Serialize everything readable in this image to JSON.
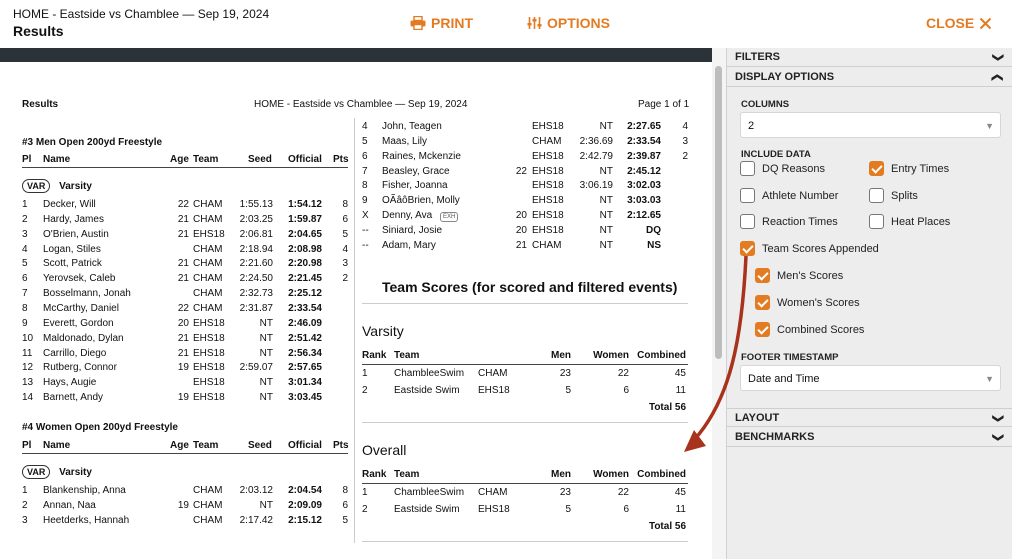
{
  "header": {
    "breadcrumb": "HOME - Eastside vs Chamblee — Sep 19, 2024",
    "title": "Results",
    "print_label": "PRINT",
    "options_label": "OPTIONS",
    "close_label": "CLOSE",
    "accent_color": "#e37b22"
  },
  "doc": {
    "heading_left": "Results",
    "heading_center": "HOME - Eastside vs Chamblee — Sep 19, 2024",
    "page_info": "Page 1 of 1",
    "columns_header": [
      "Pl",
      "Name",
      "Age",
      "Team",
      "Seed",
      "Official",
      "Pts"
    ],
    "event3": {
      "title": "#3 Men Open 200yd Freestyle",
      "group": "VAR",
      "group_label": "Varsity",
      "rows": [
        [
          "1",
          "Decker, Will",
          "22",
          "CHAM",
          "1:55.13",
          "1:54.12",
          "8"
        ],
        [
          "2",
          "Hardy, James",
          "21",
          "CHAM",
          "2:03.25",
          "1:59.87",
          "6"
        ],
        [
          "3",
          "O'Brien, Austin",
          "21",
          "EHS18",
          "2:06.81",
          "2:04.65",
          "5"
        ],
        [
          "4",
          "Logan, Stiles",
          "",
          "CHAM",
          "2:18.94",
          "2:08.98",
          "4"
        ],
        [
          "5",
          "Scott, Patrick",
          "21",
          "CHAM",
          "2:21.60",
          "2:20.98",
          "3"
        ],
        [
          "6",
          "Yerovsek, Caleb",
          "21",
          "CHAM",
          "2:24.50",
          "2:21.45",
          "2"
        ],
        [
          "7",
          "Bosselmann, Jonah",
          "",
          "CHAM",
          "2:32.73",
          "2:25.12",
          ""
        ],
        [
          "8",
          "McCarthy, Daniel",
          "22",
          "CHAM",
          "2:31.87",
          "2:33.54",
          ""
        ],
        [
          "9",
          "Everett, Gordon",
          "20",
          "EHS18",
          "NT",
          "2:46.09",
          ""
        ],
        [
          "10",
          "Maldonado, Dylan",
          "21",
          "EHS18",
          "NT",
          "2:51.42",
          ""
        ],
        [
          "11",
          "Carrillo, Diego",
          "21",
          "EHS18",
          "NT",
          "2:56.34",
          ""
        ],
        [
          "12",
          "Rutberg, Connor",
          "19",
          "EHS18",
          "2:59.07",
          "2:57.65",
          ""
        ],
        [
          "13",
          "Hays, Augie",
          "",
          "EHS18",
          "NT",
          "3:01.34",
          ""
        ],
        [
          "14",
          "Barnett, Andy",
          "19",
          "EHS18",
          "NT",
          "3:03.45",
          ""
        ]
      ]
    },
    "event4": {
      "title": "#4 Women Open 200yd Freestyle",
      "group": "VAR",
      "group_label": "Varsity",
      "rows": [
        [
          "1",
          "Blankenship, Anna",
          "",
          "CHAM",
          "2:03.12",
          "2:04.54",
          "8"
        ],
        [
          "2",
          "Annan, Naa",
          "19",
          "CHAM",
          "NT",
          "2:09.09",
          "6"
        ],
        [
          "3",
          "Heetderks, Hannah",
          "",
          "CHAM",
          "2:17.42",
          "2:15.12",
          "5"
        ]
      ],
      "rows_cont": [
        [
          "4",
          "John, Teagen",
          "",
          "EHS18",
          "NT",
          "2:27.65",
          "4"
        ],
        [
          "5",
          "Maas, Lily",
          "",
          "CHAM",
          "2:36.69",
          "2:33.54",
          "3"
        ],
        [
          "6",
          "Raines, Mckenzie",
          "",
          "EHS18",
          "2:42.79",
          "2:39.87",
          "2"
        ],
        [
          "7",
          "Beasley, Grace",
          "22",
          "EHS18",
          "NT",
          "2:45.12",
          ""
        ],
        [
          "8",
          "Fisher, Joanna",
          "",
          "EHS18",
          "3:06.19",
          "3:02.03",
          ""
        ],
        [
          "9",
          "OÃâôBrien, Molly",
          "",
          "EHS18",
          "NT",
          "3:03.03",
          ""
        ],
        [
          "X",
          "Denny, Ava",
          "20",
          "EHS18",
          "NT",
          "2:12.65",
          ""
        ],
        [
          "--",
          "Siniard, Josie",
          "20",
          "EHS18",
          "NT",
          "DQ",
          ""
        ],
        [
          "--",
          "Adam, Mary",
          "21",
          "CHAM",
          "NT",
          "NS",
          ""
        ]
      ],
      "exh_tag": "EXH"
    },
    "team_scores": {
      "title": "Team Scores (for scored and filtered events)",
      "columns": [
        "Rank",
        "Team",
        "",
        "Men",
        "Women",
        "Combined"
      ],
      "varsity": {
        "label": "Varsity",
        "rows": [
          [
            "1",
            "ChambleeSwim",
            "CHAM",
            "23",
            "22",
            "45"
          ],
          [
            "2",
            "Eastside Swim",
            "EHS18",
            "5",
            "6",
            "11"
          ]
        ],
        "total": "Total 56"
      },
      "overall": {
        "label": "Overall",
        "rows": [
          [
            "1",
            "ChambleeSwim",
            "CHAM",
            "23",
            "22",
            "45"
          ],
          [
            "2",
            "Eastside Swim",
            "EHS18",
            "5",
            "6",
            "11"
          ]
        ],
        "total": "Total 56"
      }
    }
  },
  "panel": {
    "filters": "FILTERS",
    "display_options": "DISPLAY OPTIONS",
    "columns_label": "COLUMNS",
    "columns_value": "2",
    "include_data_label": "INCLUDE DATA",
    "dq_reasons": "DQ Reasons",
    "entry_times": "Entry Times",
    "athlete_number": "Athlete Number",
    "splits": "Splits",
    "reaction_times": "Reaction Times",
    "heat_places": "Heat Places",
    "team_scores_appended": "Team Scores Appended",
    "mens_scores": "Men's Scores",
    "womens_scores": "Women's Scores",
    "combined_scores": "Combined Scores",
    "footer_timestamp_label": "FOOTER TIMESTAMP",
    "footer_timestamp_value": "Date and Time",
    "layout": "LAYOUT",
    "benchmarks": "BENCHMARKS"
  }
}
